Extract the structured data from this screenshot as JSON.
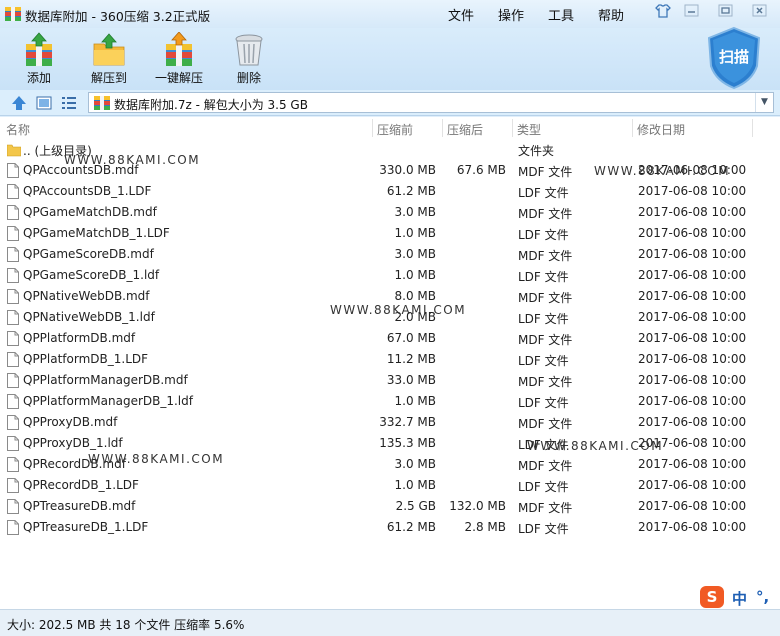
{
  "window": {
    "title": "数据库附加 - 360压缩 3.2正式版",
    "menus": [
      "文件",
      "操作",
      "工具",
      "帮助"
    ]
  },
  "toolbar": {
    "add": "添加",
    "extract_to": "解压到",
    "one_click_extract": "一键解压",
    "delete": "删除",
    "scan": "扫描"
  },
  "address": {
    "path": "数据库附加.7z - 解包大小为 3.5 GB"
  },
  "columns": {
    "name": "名称",
    "size": "压缩前",
    "packed": "压缩后",
    "type": "类型",
    "modified": "修改日期"
  },
  "parent_row": {
    "name": ".. (上级目录)",
    "type": "文件夹"
  },
  "files": [
    {
      "name": "QPAccountsDB.mdf",
      "size": "330.0 MB",
      "packed": "67.6 MB",
      "type": "MDF 文件",
      "modified": "2017-06-08 10:00"
    },
    {
      "name": "QPAccountsDB_1.LDF",
      "size": "61.2 MB",
      "packed": "",
      "type": "LDF 文件",
      "modified": "2017-06-08 10:00"
    },
    {
      "name": "QPGameMatchDB.mdf",
      "size": "3.0 MB",
      "packed": "",
      "type": "MDF 文件",
      "modified": "2017-06-08 10:00"
    },
    {
      "name": "QPGameMatchDB_1.LDF",
      "size": "1.0 MB",
      "packed": "",
      "type": "LDF 文件",
      "modified": "2017-06-08 10:00"
    },
    {
      "name": "QPGameScoreDB.mdf",
      "size": "3.0 MB",
      "packed": "",
      "type": "MDF 文件",
      "modified": "2017-06-08 10:00"
    },
    {
      "name": "QPGameScoreDB_1.ldf",
      "size": "1.0 MB",
      "packed": "",
      "type": "LDF 文件",
      "modified": "2017-06-08 10:00"
    },
    {
      "name": "QPNativeWebDB.mdf",
      "size": "8.0 MB",
      "packed": "",
      "type": "MDF 文件",
      "modified": "2017-06-08 10:00"
    },
    {
      "name": "QPNativeWebDB_1.ldf",
      "size": "2.0 MB",
      "packed": "",
      "type": "LDF 文件",
      "modified": "2017-06-08 10:00"
    },
    {
      "name": "QPPlatformDB.mdf",
      "size": "67.0 MB",
      "packed": "",
      "type": "MDF 文件",
      "modified": "2017-06-08 10:00"
    },
    {
      "name": "QPPlatformDB_1.LDF",
      "size": "11.2 MB",
      "packed": "",
      "type": "LDF 文件",
      "modified": "2017-06-08 10:00"
    },
    {
      "name": "QPPlatformManagerDB.mdf",
      "size": "33.0 MB",
      "packed": "",
      "type": "MDF 文件",
      "modified": "2017-06-08 10:00"
    },
    {
      "name": "QPPlatformManagerDB_1.ldf",
      "size": "1.0 MB",
      "packed": "",
      "type": "LDF 文件",
      "modified": "2017-06-08 10:00"
    },
    {
      "name": "QPProxyDB.mdf",
      "size": "332.7 MB",
      "packed": "",
      "type": "MDF 文件",
      "modified": "2017-06-08 10:00"
    },
    {
      "name": "QPProxyDB_1.ldf",
      "size": "135.3 MB",
      "packed": "",
      "type": "LDF 文件",
      "modified": "2017-06-08 10:00"
    },
    {
      "name": "QPRecordDB.mdf",
      "size": "3.0 MB",
      "packed": "",
      "type": "MDF 文件",
      "modified": "2017-06-08 10:00"
    },
    {
      "name": "QPRecordDB_1.LDF",
      "size": "1.0 MB",
      "packed": "",
      "type": "LDF 文件",
      "modified": "2017-06-08 10:00"
    },
    {
      "name": "QPTreasureDB.mdf",
      "size": "2.5 GB",
      "packed": "132.0 MB",
      "type": "MDF 文件",
      "modified": "2017-06-08 10:00"
    },
    {
      "name": "QPTreasureDB_1.LDF",
      "size": "61.2 MB",
      "packed": "2.8 MB",
      "type": "LDF 文件",
      "modified": "2017-06-08 10:00"
    }
  ],
  "watermark": "WWW.88KAMI.COM",
  "status": {
    "summary": "大小: 202.5 MB 共 18 个文件 压缩率 5.6%"
  },
  "ime": {
    "logo": "S",
    "mode": "中",
    "punct": "°,"
  }
}
